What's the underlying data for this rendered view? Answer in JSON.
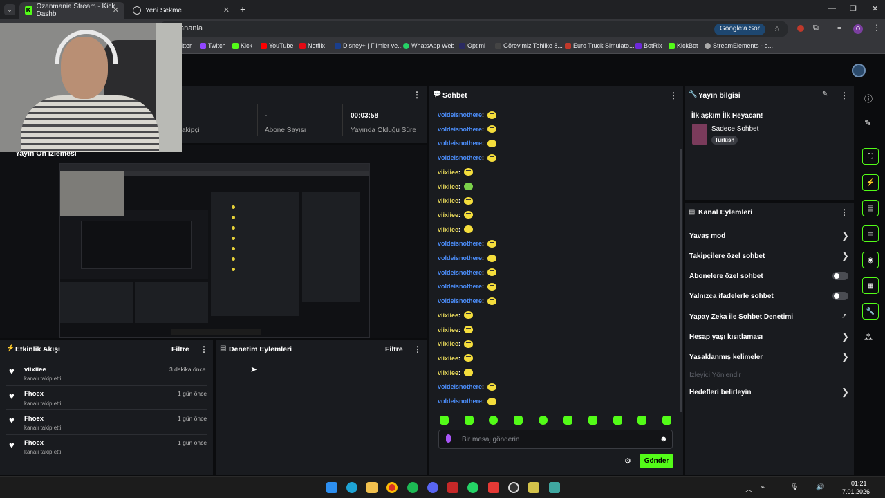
{
  "browser": {
    "tabs": [
      {
        "label": "Ozanmania Stream - Kick Dashb",
        "active": true
      },
      {
        "label": "Yeni Sekme",
        "active": false
      }
    ],
    "url_fragment": "anania",
    "google_sor": "Google'a Sor",
    "profile_initial": "O",
    "bookmarks": [
      "itter",
      "Twitch",
      "Kick",
      "YouTube",
      "Netflix",
      "Disney+ | Filmler ve...",
      "WhatsApp Web",
      "Optimi",
      "Görevimiz Tehlike 8...",
      "Euro Truck Simulato...",
      "BotRix",
      "KickBot",
      "StreamElements - o..."
    ]
  },
  "stats": {
    "followers_label": "akipçi",
    "subscribers_value": "-",
    "subscribers_label": "Abone Sayısı",
    "uptime_value": "00:03:58",
    "uptime_label": "Yayında Olduğu Süre"
  },
  "preview": {
    "title": "Yayın Ön İzlemesi"
  },
  "activity": {
    "title": "Etkinlik Akışı",
    "filter": "Filtre",
    "items": [
      {
        "name": "viixiiee",
        "sub": "kanalı takip etti",
        "time": "3 dakika önce"
      },
      {
        "name": "Fhoex",
        "sub": "kanalı takip etti",
        "time": "1 gün önce"
      },
      {
        "name": "Fhoex",
        "sub": "kanalı takip etti",
        "time": "1 gün önce"
      },
      {
        "name": "Fhoex",
        "sub": "kanalı takip etti",
        "time": "1 gün önce"
      }
    ]
  },
  "moderation": {
    "title": "Denetim Eylemleri",
    "filter": "Filtre"
  },
  "chat": {
    "title": "Sohbet",
    "messages": [
      {
        "user": "voldeisnothere",
        "color": "blue"
      },
      {
        "user": "voldeisnothere",
        "color": "blue"
      },
      {
        "user": "voldeisnothere",
        "color": "blue"
      },
      {
        "user": "voldeisnothere",
        "color": "blue"
      },
      {
        "user": "viixiiee",
        "color": "yellow"
      },
      {
        "user": "viixiiee",
        "color": "yellow",
        "green": true
      },
      {
        "user": "viixiiee",
        "color": "yellow"
      },
      {
        "user": "viixiiee",
        "color": "yellow"
      },
      {
        "user": "viixiiee",
        "color": "yellow"
      },
      {
        "user": "voldeisnothere",
        "color": "blue"
      },
      {
        "user": "voldeisnothere",
        "color": "blue"
      },
      {
        "user": "voldeisnothere",
        "color": "blue"
      },
      {
        "user": "voldeisnothere",
        "color": "blue"
      },
      {
        "user": "voldeisnothere",
        "color": "blue"
      },
      {
        "user": "viixiiee",
        "color": "yellow"
      },
      {
        "user": "viixiiee",
        "color": "yellow"
      },
      {
        "user": "viixiiee",
        "color": "yellow"
      },
      {
        "user": "viixiiee",
        "color": "yellow"
      },
      {
        "user": "viixiiee",
        "color": "yellow"
      },
      {
        "user": "voldeisnothere",
        "color": "blue"
      },
      {
        "user": "voldeisnothere",
        "color": "blue"
      }
    ],
    "input_placeholder": "Bir mesaj gönderin",
    "send": "Gönder"
  },
  "stream_info": {
    "title": "Yayın bilgisi",
    "stream_title": "İlk aşkım İlk Heyacan!",
    "category": "Sadece Sohbet",
    "language": "Turkish"
  },
  "channel_actions": {
    "title": "Kanal Eylemleri",
    "items": [
      {
        "label": "Yavaş mod",
        "control": "chevron"
      },
      {
        "label": "Takipçilere özel sohbet",
        "control": "chevron"
      },
      {
        "label": "Abonelere özel sohbet",
        "control": "toggle"
      },
      {
        "label": "Yalnızca ifadelerle sohbet",
        "control": "toggle"
      },
      {
        "label": "Yapay Zeka ile Sohbet Denetimi",
        "control": "external"
      },
      {
        "label": "Hesap yaşı kısıtlaması",
        "control": "chevron"
      },
      {
        "label": "Yasaklanmış kelimeler",
        "control": "chevron"
      },
      {
        "label": "İzleyici Yönlendir",
        "control": "none",
        "disabled": true
      },
      {
        "label": "Hedefleri belirleyin",
        "control": "chevron"
      }
    ]
  },
  "taskbar": {
    "time": "01:21",
    "date": "7.01.2026"
  },
  "colors": {
    "accent": "#53fc18",
    "panel": "#191b1f",
    "username_blue": "#4b8cf7",
    "username_yellow": "#e8d95a"
  }
}
